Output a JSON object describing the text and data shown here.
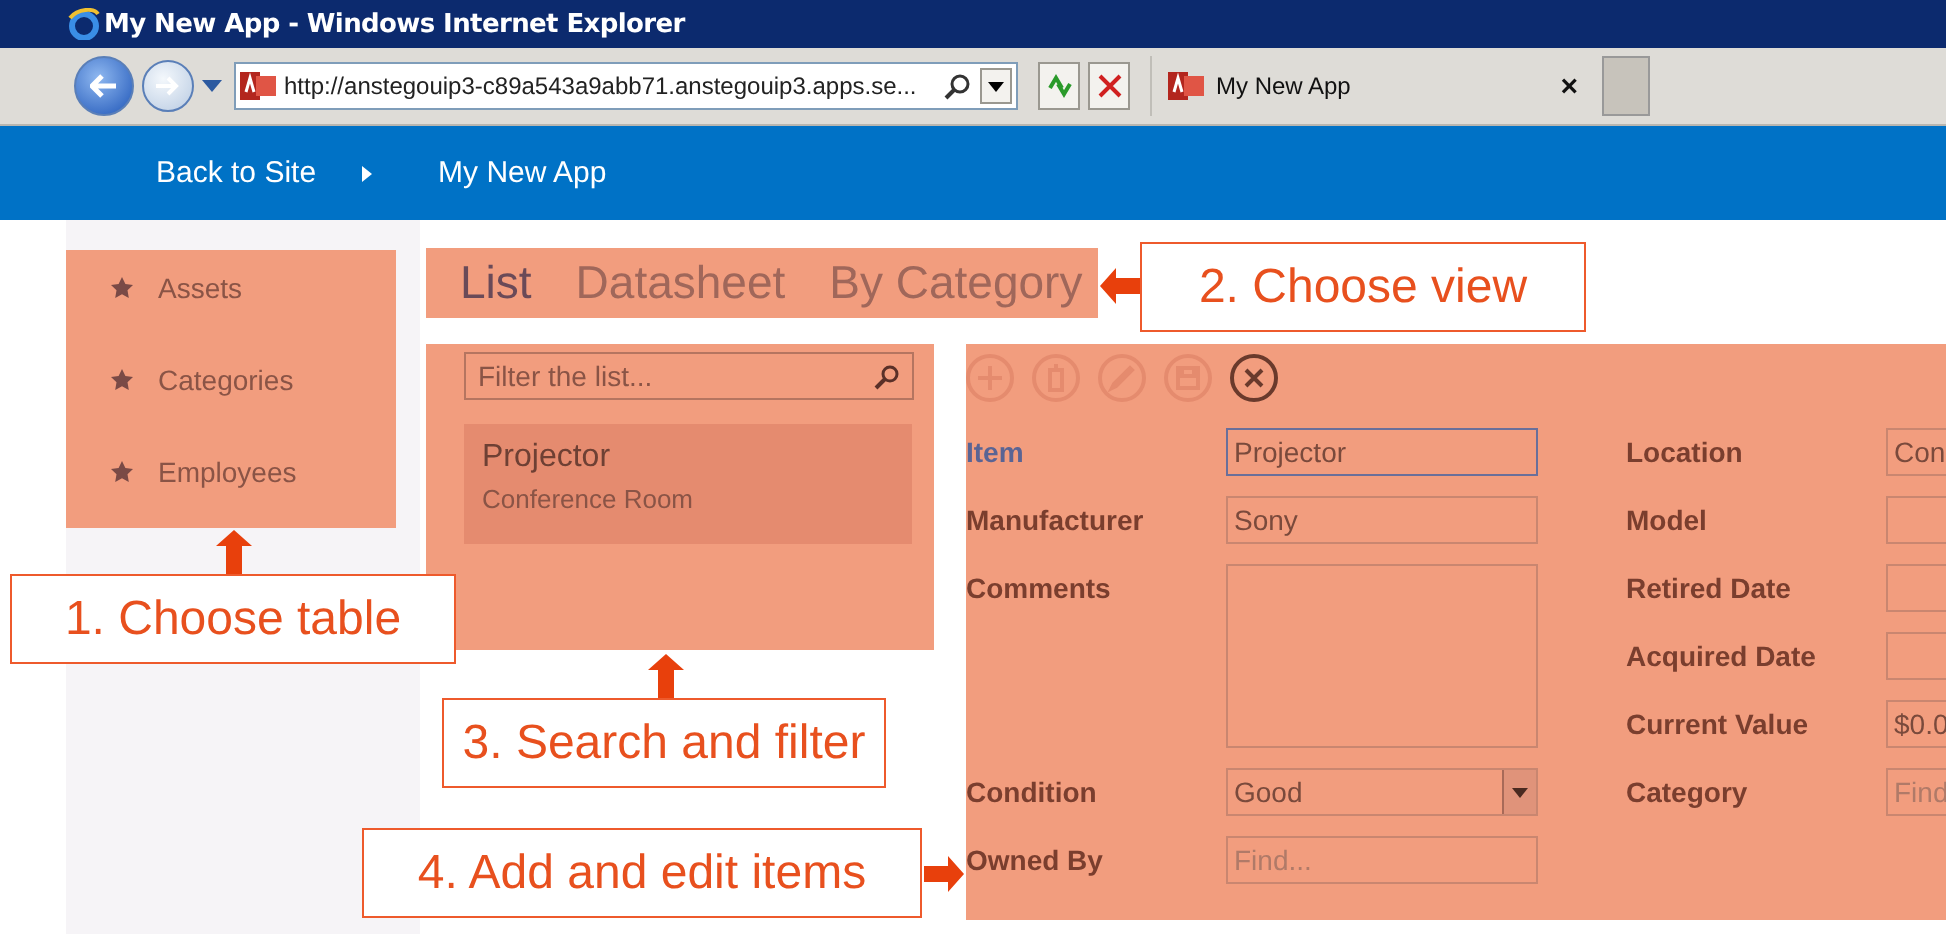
{
  "window": {
    "title": "My New App - Windows Internet Explorer"
  },
  "address_bar": {
    "url": "http://anstegouip3-c89a543a9abb71.anstegouip3.apps.se..."
  },
  "browser_tabs": [
    {
      "label": "My New App",
      "selected": true,
      "close": "×"
    }
  ],
  "nav": {
    "back": "Back to Site",
    "app_title": "My New App"
  },
  "sidebar": {
    "items": [
      {
        "label": "Assets"
      },
      {
        "label": "Categories"
      },
      {
        "label": "Employees"
      }
    ]
  },
  "views": [
    {
      "label": "List",
      "selected": true
    },
    {
      "label": "Datasheet",
      "selected": false
    },
    {
      "label": "By Category",
      "selected": false
    }
  ],
  "filter": {
    "placeholder": "Filter the list..."
  },
  "list_items": [
    {
      "title": "Projector",
      "subtitle": "Conference Room",
      "selected": true
    }
  ],
  "form": {
    "actions": [
      {
        "kind": "add",
        "enabled": false
      },
      {
        "kind": "delete",
        "enabled": false
      },
      {
        "kind": "edit",
        "enabled": false
      },
      {
        "kind": "save",
        "enabled": false
      },
      {
        "kind": "close",
        "enabled": true
      }
    ],
    "left": [
      {
        "label": "Item",
        "kind": "text",
        "value": "Projector",
        "focused": true
      },
      {
        "label": "Manufacturer",
        "kind": "text",
        "value": "Sony",
        "focused": false
      },
      {
        "label": "Comments",
        "kind": "textarea",
        "focused": false
      },
      {
        "label": "Condition",
        "kind": "select",
        "value": "Good",
        "focused": false
      },
      {
        "label": "Owned By",
        "kind": "lookup",
        "placeholder": "Find...",
        "focused": false
      }
    ],
    "right": [
      {
        "label": "Location",
        "kind": "text",
        "value": "Con",
        "focused": false
      },
      {
        "label": "Model",
        "kind": "text",
        "focused": false
      },
      {
        "label": "Retired Date",
        "kind": "text",
        "focused": false
      },
      {
        "label": "Acquired Date",
        "kind": "text",
        "focused": false
      },
      {
        "label": "Current Value",
        "kind": "text",
        "value": "$0.0",
        "focused": false
      },
      {
        "label": "Category",
        "kind": "lookup",
        "placeholder": "Find",
        "focused": false
      }
    ]
  },
  "callouts": [
    {
      "text": "1. Choose table"
    },
    {
      "text": "2. Choose view"
    },
    {
      "text": "3. Search and filter"
    },
    {
      "text": "4. Add and edit items"
    }
  ]
}
